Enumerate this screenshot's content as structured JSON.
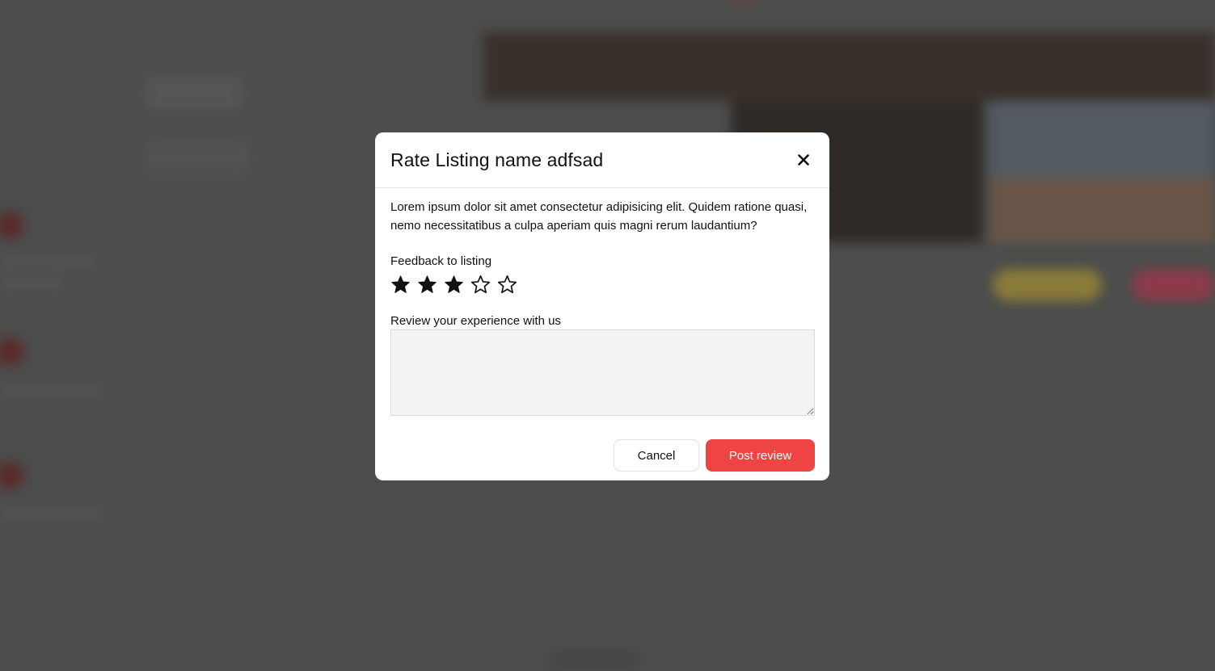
{
  "modal": {
    "title": "Rate Listing name adfsad",
    "close_icon": "close-icon",
    "description": "Lorem ipsum dolor sit amet consectetur adipisicing elit. Quidem ratione quasi, nemo necessitatibus a culpa aperiam quis magni rerum laudantium?",
    "feedback_label": "Feedback to listing",
    "rating": {
      "value": 3,
      "max": 5
    },
    "review_label": "Review your experience with us",
    "review_value": "",
    "cancel_label": "Cancel",
    "post_label": "Post review"
  },
  "colors": {
    "overlay": "#4c4d4c",
    "primary": "#ef4444",
    "textarea_bg": "#f2f3f5"
  }
}
